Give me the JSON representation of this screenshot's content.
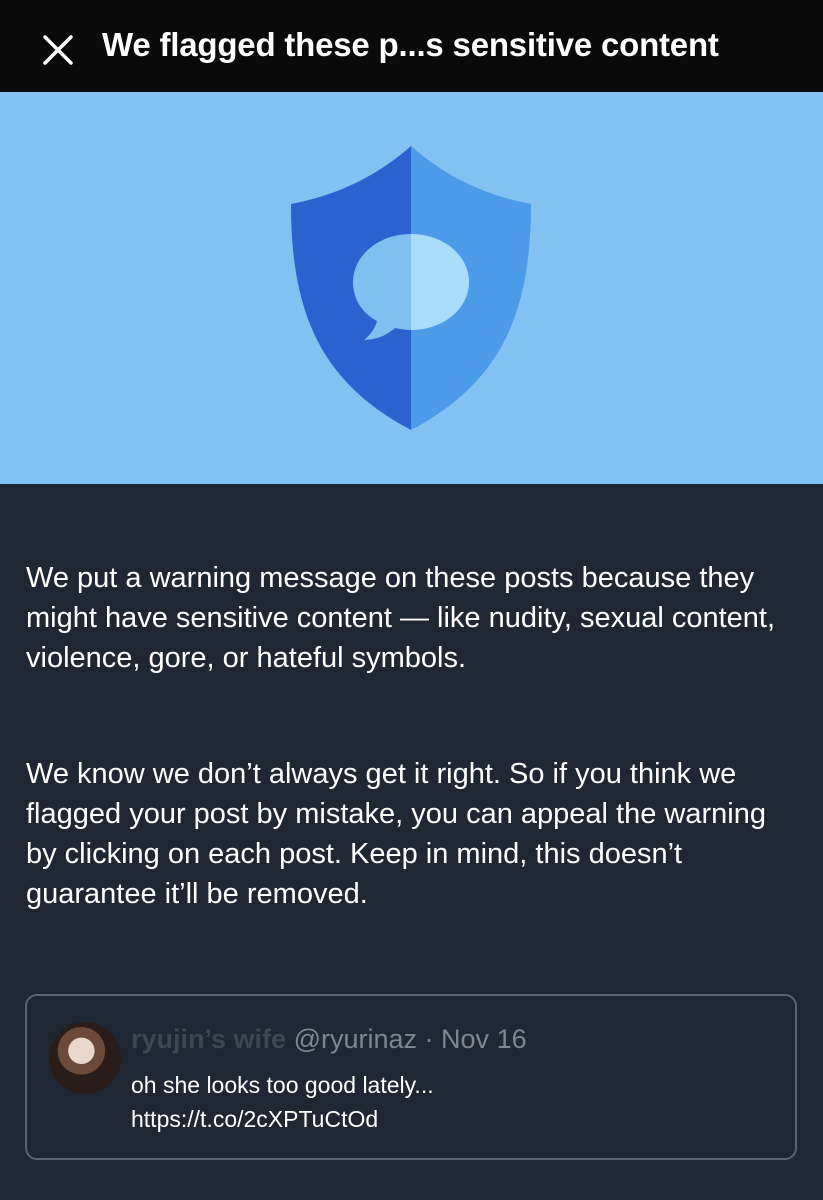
{
  "header": {
    "title": "We flagged these p...s sensitive content",
    "close_icon": "close-icon"
  },
  "hero": {
    "background": "#82c2f2",
    "illustration": "shield-chat-icon"
  },
  "content": {
    "paragraph1": "We put a warning message on these posts because they might have sensitive content — like nudity, sexual content, violence, gore, or hateful symbols.",
    "paragraph2": "We know we don’t always get it right. So if you think we flagged your post by mistake, you can appeal the warning by clicking on each post. Keep in mind, this doesn’t guarantee it’ll be removed."
  },
  "quoted_post": {
    "display_name": "ryujin’s wife",
    "handle": "@ryurinaz",
    "separator": "·",
    "date": "Nov 16",
    "text_line1": "oh she looks too good lately...",
    "text_line2": "https://t.co/2cXPTuCtOd"
  },
  "colors": {
    "background": "#1e2733",
    "topbar": "#0a0a0a",
    "shield_dark": "#2a62d0",
    "shield_light": "#4b9be8"
  }
}
